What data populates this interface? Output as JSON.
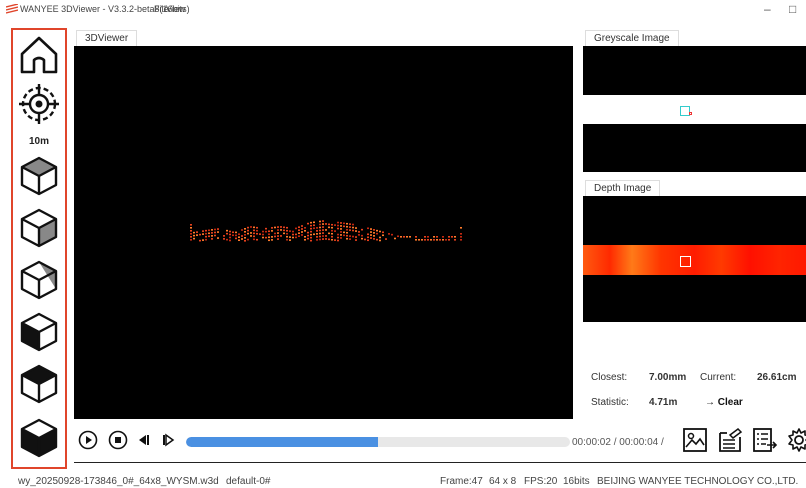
{
  "window": {
    "title": "WANYEE 3DViewer - V3.3.2-beta8(16bits)",
    "menu_file": "File",
    "menu_view": "View",
    "minimize": "–",
    "maximize": "□"
  },
  "toolbar": {
    "distance_label": "10m"
  },
  "tabs": {
    "viewer": "3DViewer",
    "greyscale": "Greyscale Image",
    "depth": "Depth Image"
  },
  "stats": {
    "closest_label": "Closest:",
    "closest_value": "7.00mm",
    "current_label": "Current:",
    "current_value": "26.61cm",
    "statistic_label": "Statistic:",
    "statistic_value": "4.71m",
    "clear_label": "→ Clear"
  },
  "playback": {
    "progress": 0.5,
    "time": "00:00:02 / 00:00:04 /"
  },
  "statusbar": {
    "file": "wy_20250928-173846_0#_64x8_WYSM.w3d",
    "profile": "default-0#",
    "frame": "Frame:47",
    "resolution": "64 x 8",
    "fps": "FPS:20",
    "bits": "16bits",
    "company": "BEIJING WANYEE TECHNOLOGY CO.,LTD."
  },
  "colors": {
    "accent": "#4a90e2",
    "toolbar_border": "#e0452b",
    "point_cloud": "#e8401c"
  }
}
